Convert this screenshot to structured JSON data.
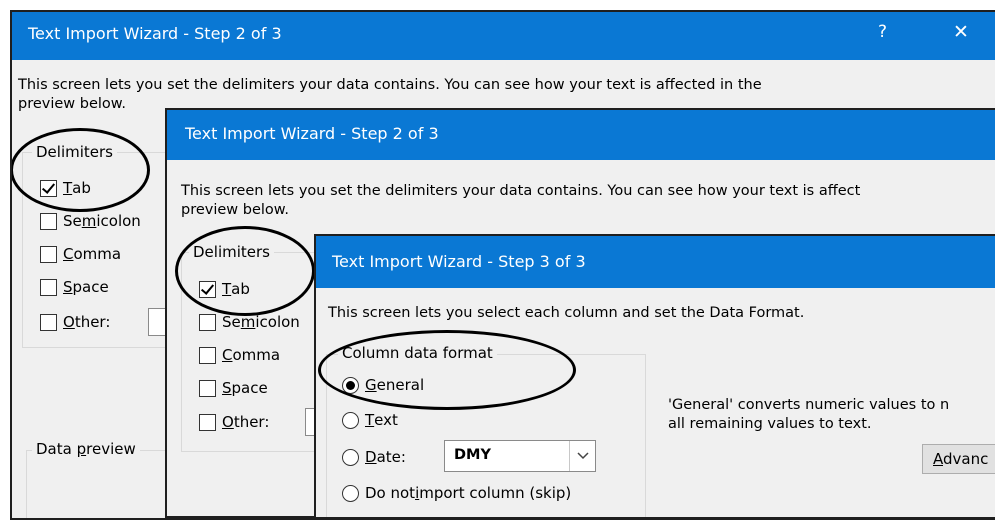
{
  "window1": {
    "title": "Text Import Wizard - Step 2 of 3",
    "help_icon_glyph": "?",
    "close_icon_glyph": "✕",
    "description_line1": "This screen lets you set the delimiters your data contains.  You can see how your text is affected in the",
    "description_line2": "preview below.",
    "delimiters": {
      "legend": "Delimiters",
      "tab": {
        "pre": "",
        "u": "T",
        "post": "ab",
        "checked": true
      },
      "semicolon": {
        "pre": "Se",
        "u": "m",
        "post": "icolon",
        "checked": false
      },
      "comma": {
        "pre": "",
        "u": "C",
        "post": "omma",
        "checked": false
      },
      "space": {
        "pre": "",
        "u": "S",
        "post": "pace",
        "checked": false
      },
      "other": {
        "pre": "",
        "u": "O",
        "post": "ther:",
        "checked": false
      }
    },
    "data_preview": {
      "pre": "Data ",
      "u": "p",
      "post": "review"
    }
  },
  "window2": {
    "title": "Text Import Wizard - Step 2 of 3",
    "description_line1": "This screen lets you set the delimiters your data contains.  You can see how your text is affect",
    "description_line2": "preview below.",
    "delimiters": {
      "legend": "Delimiters",
      "tab": {
        "pre": "",
        "u": "T",
        "post": "ab",
        "checked": true
      },
      "semicolon": {
        "pre": "Se",
        "u": "m",
        "post": "icolon",
        "checked": false
      },
      "comma": {
        "pre": "",
        "u": "C",
        "post": "omma",
        "checked": false
      },
      "space": {
        "pre": "",
        "u": "S",
        "post": "pace",
        "checked": false
      },
      "other": {
        "pre": "",
        "u": "O",
        "post": "ther:",
        "checked": false
      }
    }
  },
  "window3": {
    "title": "Text Import Wizard - Step 3 of 3",
    "description": "This screen lets you select each column and set the Data Format.",
    "column_format": {
      "legend": "Column data format",
      "general": {
        "pre": "",
        "u": "G",
        "post": "eneral",
        "checked": true
      },
      "text": {
        "pre": "",
        "u": "T",
        "post": "ext",
        "checked": false
      },
      "date": {
        "pre": "",
        "u": "D",
        "post": "ate:",
        "checked": false
      },
      "skip": {
        "pre": "Do not ",
        "u": "i",
        "post": "mport column (skip)",
        "checked": false
      }
    },
    "date_select_value": "DMY",
    "info_line1": "'General' converts numeric values to n",
    "info_line2": "all remaining values to text.",
    "advanced_button": {
      "pre": "",
      "u": "A",
      "post": "dvanc"
    }
  }
}
